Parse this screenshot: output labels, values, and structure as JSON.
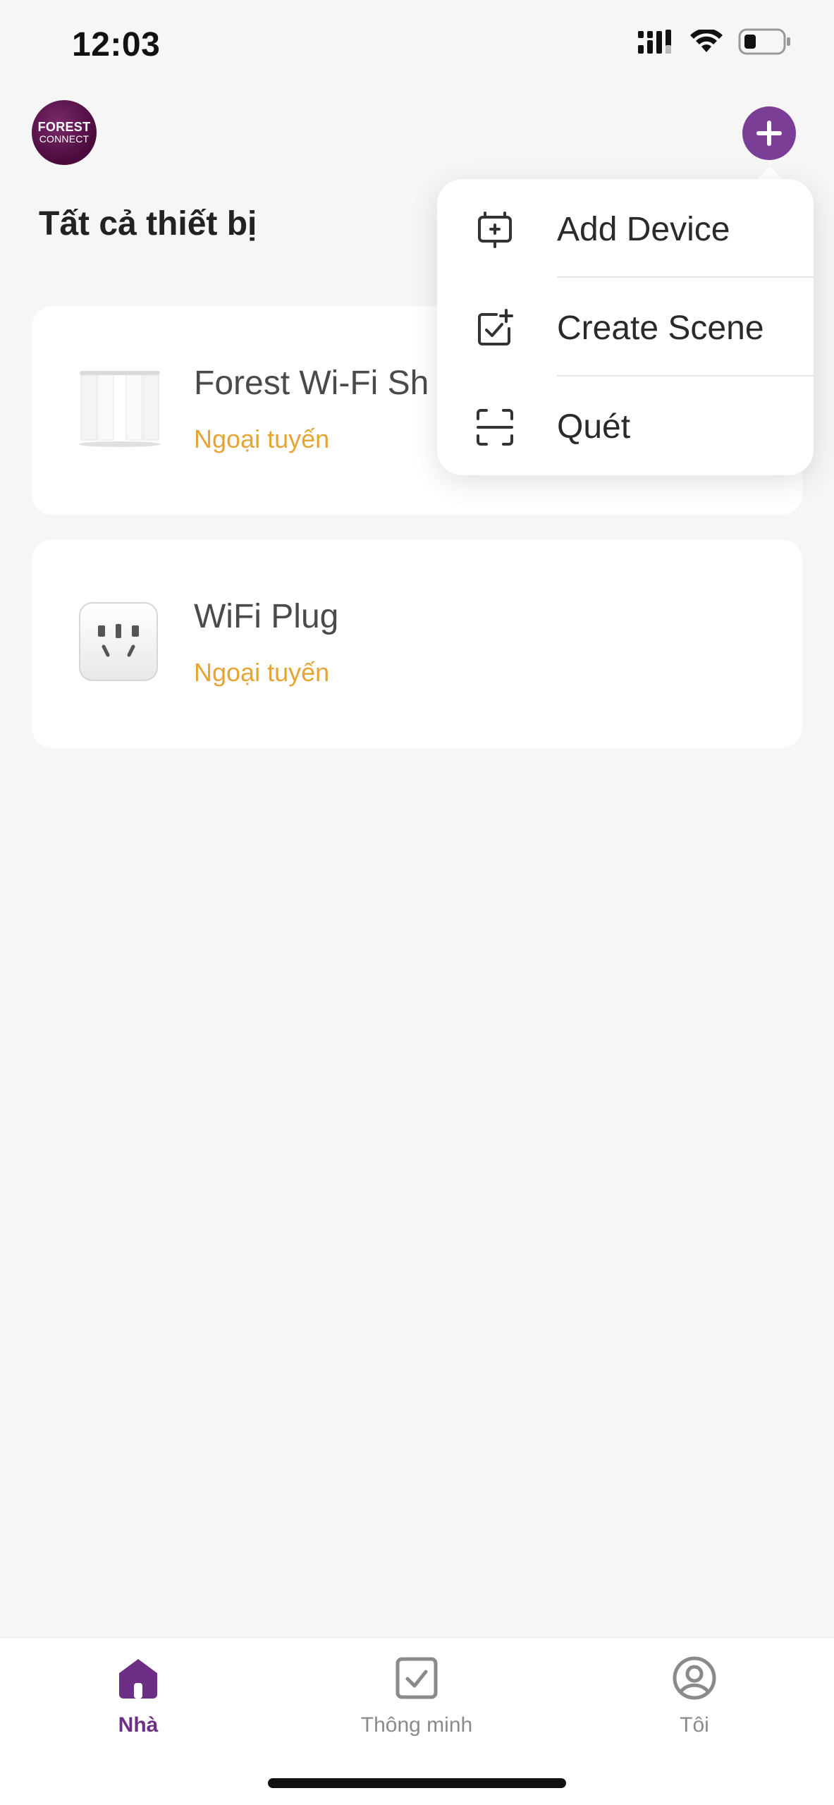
{
  "status_bar": {
    "time": "12:03"
  },
  "header": {
    "logo": {
      "line1": "FOREST",
      "line2": "CONNECT"
    },
    "title": "Tất cả thiết bị"
  },
  "devices": [
    {
      "name": "Forest Wi-Fi Sh",
      "status": "Ngoại tuyến",
      "icon": "curtain-icon"
    },
    {
      "name": "WiFi Plug",
      "status": "Ngoại tuyến",
      "icon": "plug-icon"
    }
  ],
  "menu": {
    "items": [
      {
        "label": "Add Device",
        "icon": "add-device-icon"
      },
      {
        "label": "Create Scene",
        "icon": "create-scene-icon"
      },
      {
        "label": "Quét",
        "icon": "scan-icon"
      }
    ]
  },
  "tabs": [
    {
      "label": "Nhà",
      "icon": "home-icon",
      "active": true
    },
    {
      "label": "Thông minh",
      "icon": "smart-check-icon",
      "active": false
    },
    {
      "label": "Tôi",
      "icon": "profile-icon",
      "active": false
    }
  ],
  "colors": {
    "accent": "#7a3e96",
    "active_tab": "#6d2f86",
    "offline": "#e6a435",
    "background": "#f6f6f6"
  }
}
